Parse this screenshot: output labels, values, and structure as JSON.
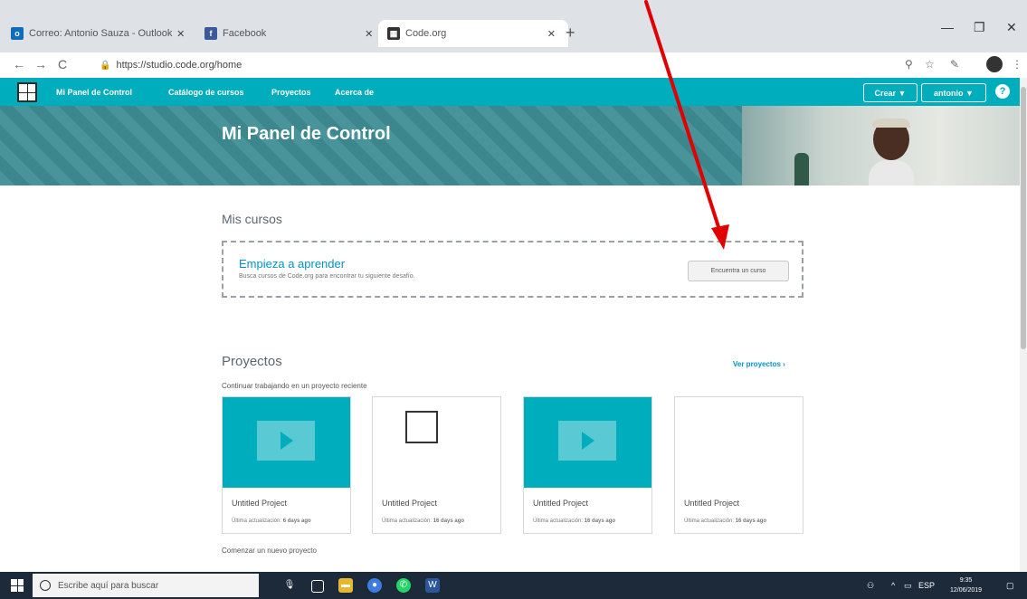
{
  "browser": {
    "tabs": [
      {
        "title": "Correo: Antonio Sauza - Outlook"
      },
      {
        "title": "Facebook"
      },
      {
        "title": "Code.org"
      }
    ],
    "url": "https://studio.code.org/home"
  },
  "header": {
    "nav": [
      "Mi Panel de Control",
      "Catálogo de cursos",
      "Proyectos",
      "Acerca de"
    ],
    "create_label": "Crear ▼",
    "user_label": "antonio ▼",
    "help_label": "?"
  },
  "banner": {
    "title": "Mi Panel de Control"
  },
  "courses": {
    "heading": "Mis cursos",
    "empty_title": "Empieza a aprender",
    "empty_text": "Busca cursos de Code.org para encontrar tu siguiente desafío.",
    "find_button": "Encuentra un curso"
  },
  "projects": {
    "heading": "Proyectos",
    "view_all": "Ver proyectos ›",
    "continue_label": "Continuar trabajando en un proyecto reciente",
    "cards": [
      {
        "name": "Untitled Project",
        "prefix": "Última actualización:",
        "ago": "6 days ago"
      },
      {
        "name": "Untitled Project",
        "prefix": "Última actualización:",
        "ago": "16 days ago"
      },
      {
        "name": "Untitled Project",
        "prefix": "Última actualización:",
        "ago": "16 days ago"
      },
      {
        "name": "Untitled Project",
        "prefix": "Última actualización:",
        "ago": "16 days ago"
      }
    ],
    "new_project_label": "Comenzar un nuevo proyecto"
  },
  "taskbar": {
    "search_placeholder": "Escribe aquí para buscar",
    "tray_text": "ESP",
    "time": "9:35",
    "date": "12/06/2019"
  },
  "annotation": {
    "arrow_color": "#e00000"
  },
  "colors": {
    "brand_teal": "#00adbc",
    "link_blue": "#0094ca"
  }
}
